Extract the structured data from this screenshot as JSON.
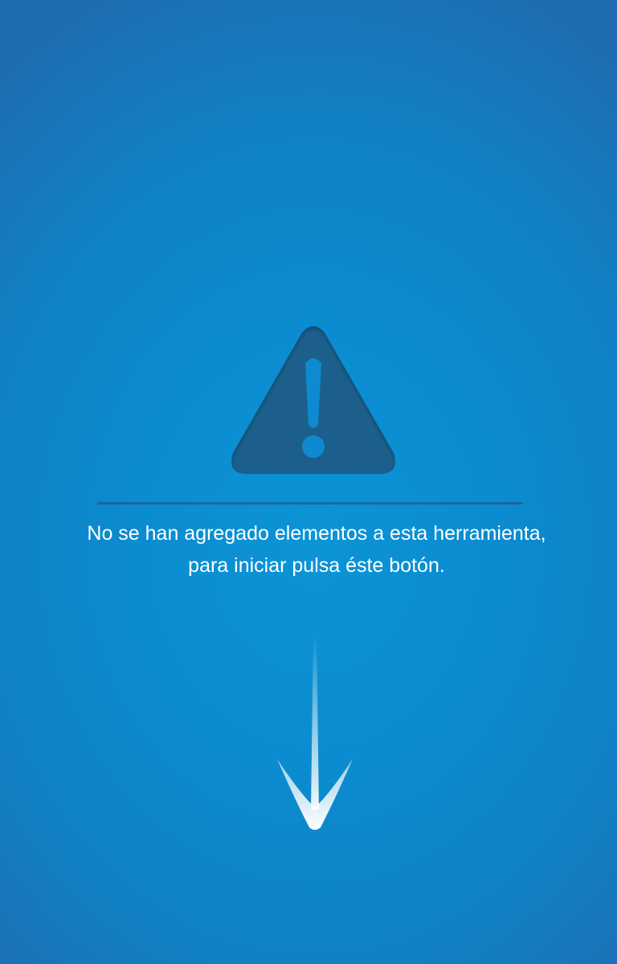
{
  "empty_state": {
    "icon": "warning-triangle-icon",
    "message_line1": "No se han agregado elementos a esta herramienta,",
    "message_line2": "para iniciar pulsa éste botón.",
    "hint_icon": "arrow-down-icon"
  },
  "colors": {
    "background": "#0b8cd0",
    "icon_fill": "#1c5f8c",
    "text": "#ffffff"
  }
}
